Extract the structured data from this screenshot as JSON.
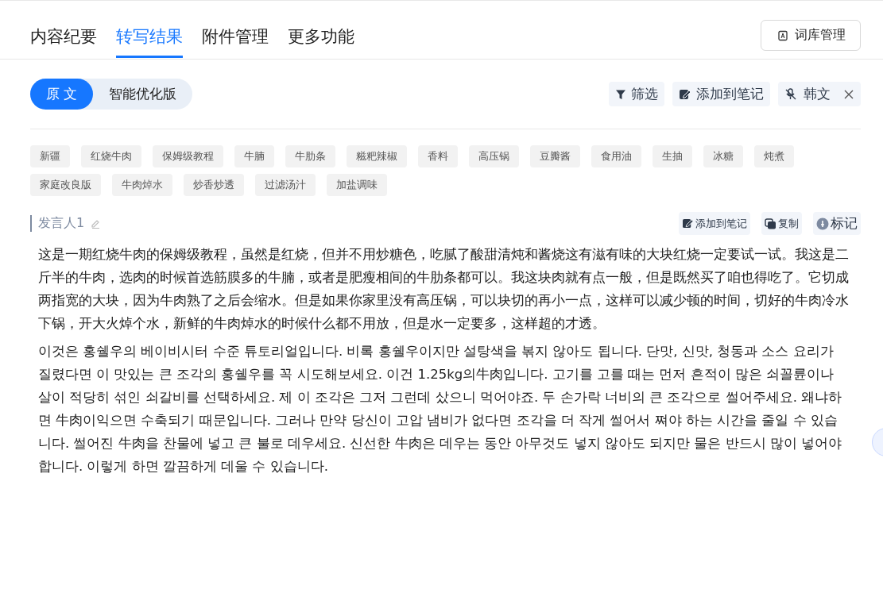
{
  "tabs": [
    {
      "label": "内容纪要",
      "selected": false
    },
    {
      "label": "转写结果",
      "selected": true
    },
    {
      "label": "附件管理",
      "selected": false
    },
    {
      "label": "更多功能",
      "selected": false
    }
  ],
  "lexicon_button": {
    "label": "词库管理"
  },
  "view_toggle": [
    {
      "label": "原 文",
      "selected": true
    },
    {
      "label": "智能优化版",
      "selected": false
    }
  ],
  "toolbar": {
    "filter": "筛选",
    "add_to_notes": "添加到笔记",
    "language": "韩文"
  },
  "keywords": [
    "新疆",
    "红烧牛肉",
    "保姆级教程",
    "牛腩",
    "牛肋条",
    "糍粑辣椒",
    "香料",
    "高压锅",
    "豆瓣酱",
    "食用油",
    "生抽",
    "冰糖",
    "炖煮",
    "家庭改良版",
    "牛肉焯水",
    "炒香炒透",
    "过滤汤汁",
    "加盐调味"
  ],
  "speaker": {
    "name": "发言人1",
    "actions": {
      "add_to_notes": "添加到笔记",
      "copy": "复制",
      "mark": "标记"
    }
  },
  "paragraphs": [
    "这是一期红烧牛肉的保姆级教程，虽然是红烧，但并不用炒糖色，吃腻了酸甜清炖和酱烧这有滋有味的大块红烧一定要试一试。我这是二斤半的牛肉，选肉的时候首选筋膜多的牛腩，或者是肥瘦相间的牛肋条都可以。我这块肉就有点一般，但是既然买了咱也得吃了。它切成两指宽的大块，因为牛肉熟了之后会缩水。但是如果你家里没有高压锅，可以块切的再小一点，这样可以减少顿的时间，切好的牛肉冷水下锅，开大火焯个水，新鲜的牛肉焯水的时候什么都不用放，但是水一定要多，这样超的才透。",
    "이것은 홍쉘우의 베이비시터 수준 튜토리얼입니다. 비록 홍쉘우이지만 설탕색을 볶지 않아도 됩니다. 단맛, 신맛, 청동과 소스 요리가 질렸다면 이 맛있는 큰 조각의 홍쉘우를 꼭 시도해보세요. 이건 1.25kg의牛肉입니다. 고기를 고를 때는 먼저 흔적이 많은 쇠꼴륜이나 살이 적당히 섞인 쇠갈비를 선택하세요. 제 이 조각은 그저 그런데 샀으니 먹어야죠. 두 손가락 너비의 큰 조각으로 썰어주세요. 왜냐하면 牛肉이익으면 수축되기 때문입니다. 그러나 만약 당신이 고압 냄비가 없다면 조각을 더 작게 썰어서 쪄야 하는 시간을 줄일 수 있습니다. 썰어진 牛肉을 찬물에 넣고 큰 불로 데우세요. 신선한 牛肉은 데우는 동안 아무것도 넣지 않아도 되지만 물은 반드시 많이 넣어야 합니다. 이렇게 하면 깔끔하게 데울 수 있습니다."
  ]
}
